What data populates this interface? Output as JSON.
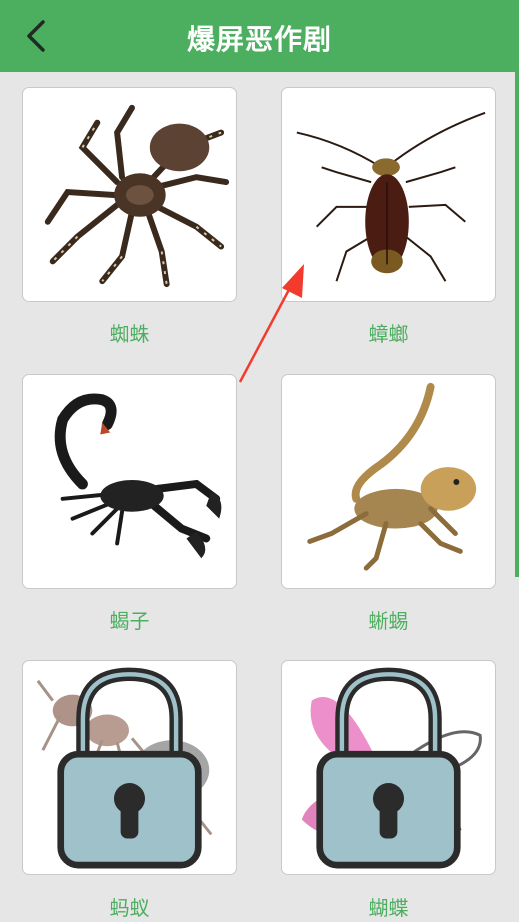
{
  "header": {
    "title": "爆屏恶作剧",
    "back_icon": "chevron-left-icon",
    "background": "#4caf5f"
  },
  "grid": {
    "items": [
      {
        "label": "蜘蛛",
        "icon": "spider-image",
        "locked": false
      },
      {
        "label": "蟑螂",
        "icon": "cockroach-image",
        "locked": false
      },
      {
        "label": "蝎子",
        "icon": "scorpion-image",
        "locked": false
      },
      {
        "label": "蜥蜴",
        "icon": "lizard-image",
        "locked": false
      },
      {
        "label": "蚂蚁",
        "icon": "ant-image",
        "locked": true
      },
      {
        "label": "蝴蝶",
        "icon": "butterfly-image",
        "locked": true
      }
    ]
  },
  "colors": {
    "accent": "#4caf5f",
    "label_text": "#4caf5f",
    "annotation_arrow": "#f23b2c"
  }
}
